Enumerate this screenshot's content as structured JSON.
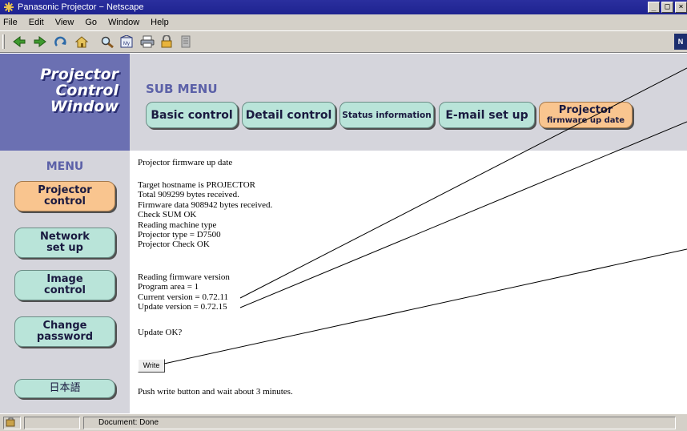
{
  "window": {
    "title": "Panasonic Projector − Netscape"
  },
  "menubar": [
    "File",
    "Edit",
    "View",
    "Go",
    "Window",
    "Help"
  ],
  "toolbar": {
    "icons": [
      "back-icon",
      "forward-icon",
      "reload-icon",
      "home-icon",
      "search-icon",
      "my-netscape-icon",
      "print-icon",
      "security-icon",
      "stop-icon"
    ],
    "my_label": "My",
    "brand": "N"
  },
  "logo": {
    "line1": "Projector",
    "line2": "Control",
    "line3": "Window"
  },
  "submenu": {
    "title": "SUB MENU",
    "buttons": [
      "Basic control",
      "Detail control",
      "Status information",
      "E-mail set up"
    ],
    "active_line1": "Projector",
    "active_line2": "firmware up date"
  },
  "menu": {
    "title": "MENU",
    "projector_control": [
      "Projector",
      "control"
    ],
    "network_setup": [
      "Network",
      "set up"
    ],
    "image_control": [
      "Image",
      "control"
    ],
    "change_password": [
      "Change",
      "password"
    ],
    "japanese": "日本語"
  },
  "content": {
    "heading": "Projector firmware up date",
    "lines": [
      "Target hostname is PROJECTOR",
      "Total 909299 bytes received.",
      "Firmware data 908942 bytes received.",
      "Check SUM OK",
      "Reading machine type",
      "Projector type = D7500",
      "Projector Check OK"
    ],
    "version_lines": [
      "Reading firmware version",
      "Program area = 1",
      "Current version = 0.72.11",
      "Update version = 0.72.15"
    ],
    "confirm": "Update OK?",
    "write_button": "Write",
    "instruction": "Push write button and wait about 3 minutes."
  },
  "statusbar": {
    "text": "Document: Done"
  },
  "colors": {
    "active_button": "#f9c58f",
    "button": "#b9e4d9",
    "logo_panel": "#6b70b2",
    "panel": "#d5d5dc"
  }
}
